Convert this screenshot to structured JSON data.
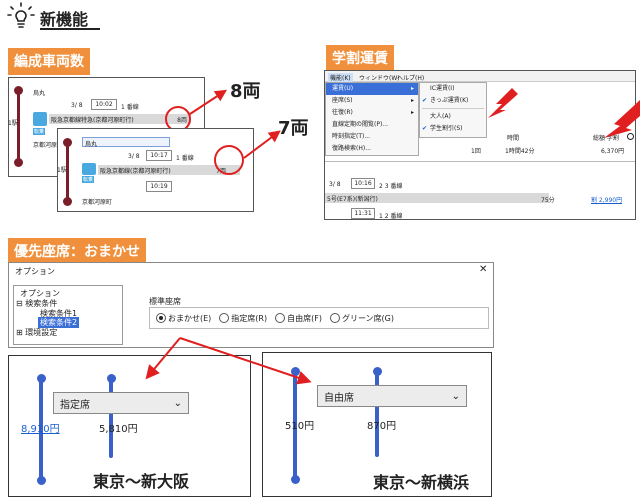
{
  "header": {
    "title": "新機能"
  },
  "sections": {
    "formation": "編成車両数",
    "student": "学割運賃",
    "priority": "優先座席：おまかせ"
  },
  "formation": {
    "callout_8": "8両",
    "callout_7": "7両",
    "back": {
      "station_top": "烏丸",
      "date": "3/ 8",
      "time": "10:02",
      "track": "1 番線",
      "line": "阪急京都線特急(京都河原町行)",
      "cars": "8両",
      "station_bottom": "京都河原町",
      "left_label": "1駅",
      "badge": "転乗"
    },
    "front": {
      "station_top": "烏丸",
      "date": "3/ 8",
      "time": "10:17",
      "track": "1 番線",
      "line": "阪急京都線(京都河原町行)",
      "cars": "7両",
      "time2": "10:19",
      "station_bottom": "京都河原町",
      "left_label": "1駅",
      "badge": "転乗"
    }
  },
  "student": {
    "menubar": [
      "機能(K)",
      "ウィンドウ(W)",
      "ヘルプ(H)"
    ],
    "menu": [
      "運賃(U)",
      "座席(S)",
      "往復(R)",
      "直線定期の閲覧(P)...",
      "時刻指定(T)...",
      "復路検索(H)..."
    ],
    "submenu": [
      "IC運賃(I)",
      "きっぷ運賃(K)",
      "大人(A)",
      "学生割引(S)"
    ],
    "col_time": "時間",
    "col_total": "総額 学割",
    "row1_transfers": "1回",
    "row1_time": "1時間42分",
    "row1_total": "6,370円",
    "row2_date": "3/ 8",
    "row2_time": "10:16",
    "row2_track": "2 3 番線",
    "row3_line": "5号(E7系)(新潟行)",
    "row3_distance": "75分",
    "row3_fare": "割 2,990円",
    "row4_time": "11:31",
    "row4_track": "1 2 番線"
  },
  "options": {
    "title": "オプション",
    "close": "✕",
    "tree_root": "オプション",
    "tree_search": "検索条件",
    "tree_search1": "検索条件1",
    "tree_search2": "検索条件2",
    "tree_env": "環境設定",
    "group_label": "標準座席",
    "radios": [
      "おまかせ(E)",
      "指定席(R)",
      "自由席(F)",
      "グリーン席(G)"
    ]
  },
  "example_left": {
    "dropdown": "指定席",
    "fare1": "8,910円",
    "fare2": "5,810円",
    "route": "東京～新大阪"
  },
  "example_right": {
    "dropdown": "自由席",
    "fare1": "510円",
    "fare2": "870円",
    "route": "東京～新横浜"
  },
  "colors": {
    "accent_orange": "#f0903c",
    "red": "#e02020",
    "blue": "#3a60c9",
    "menu_blue": "#3b6fd8"
  }
}
